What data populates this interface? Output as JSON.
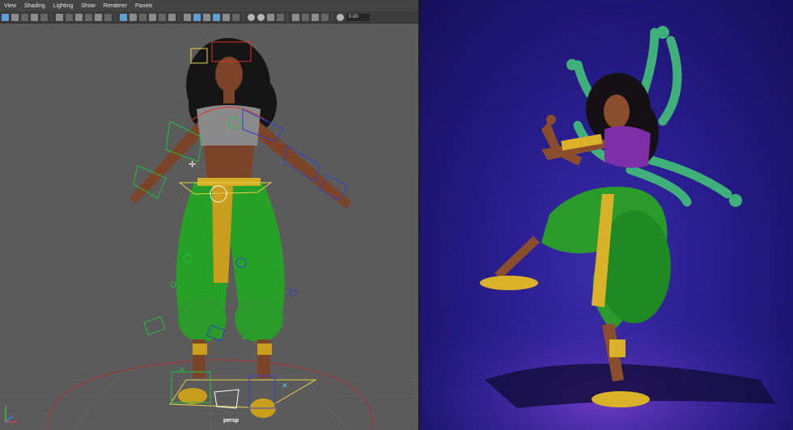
{
  "viewport": {
    "menu": [
      "View",
      "Shading",
      "Lighting",
      "Show",
      "Renderer",
      "Panels"
    ],
    "field_value": "0.00",
    "camera_label": "persp"
  },
  "toolbar_icons": [
    "select-tool-icon",
    "lasso-icon",
    "paint-icon",
    "camera-icon",
    "bookmark-icon",
    "film-gate-icon",
    "grid-icon",
    "wireframe-icon",
    "smooth-shade-icon",
    "texture-icon",
    "lighting-icon",
    "shadow-icon",
    "xray-icon",
    "isolate-icon",
    "resolution-gate-icon",
    "exposure-icon"
  ],
  "colors": {
    "viewport_bg": "#5b5b5b",
    "render_bg": "#2a1f92",
    "pants": "#2a9a2a",
    "gold": "#d9b22a",
    "skin": "#8a4e2c",
    "arms_extra": "#3fb07a"
  }
}
